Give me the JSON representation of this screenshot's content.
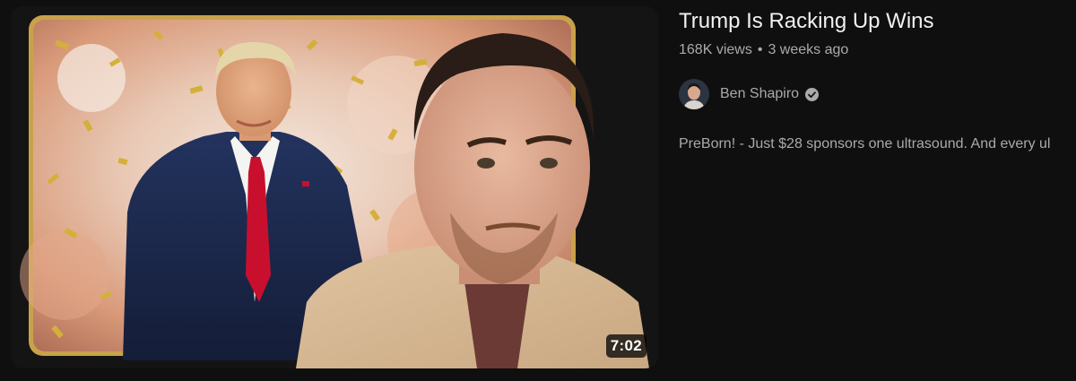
{
  "video": {
    "title": "Trump Is Racking Up Wins",
    "views": "168K views",
    "separator": "•",
    "age": "3 weeks ago",
    "duration": "7:02",
    "channel": {
      "name": "Ben Shapiro",
      "verified_icon": "verified-check-icon",
      "avatar_icon": "channel-avatar"
    },
    "description": "PreBorn! - Just $28 sponsors one ultrasound. And every ul"
  },
  "colors": {
    "background": "#0f0f0f",
    "title": "#f1f1f1",
    "secondary_text": "#aaaaaa",
    "thumbnail_frame": "#c8a24a",
    "confetti": "#d4b03a"
  }
}
